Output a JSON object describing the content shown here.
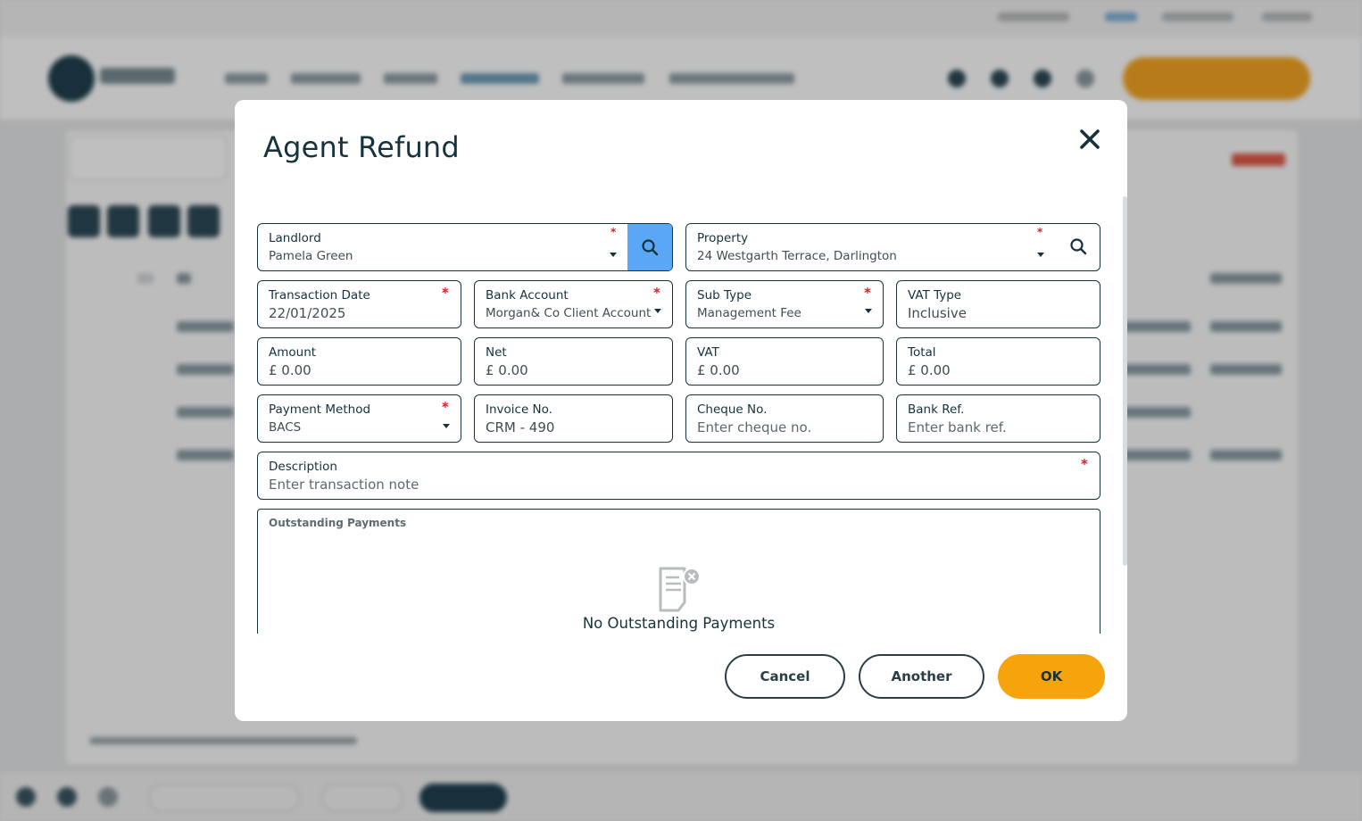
{
  "modal": {
    "title": "Agent Refund",
    "close_icon": "close-icon",
    "fields": {
      "landlord": {
        "label": "Landlord",
        "value": "Pamela Green",
        "required_mark": "*"
      },
      "property": {
        "label": "Property",
        "value": "24 Westgarth Terrace, Darlington",
        "required_mark": "*"
      },
      "transaction_date": {
        "label": "Transaction Date",
        "value": "22/01/2025",
        "required_mark": "*"
      },
      "bank_account": {
        "label": "Bank Account",
        "value": "Morgan& Co Client Account",
        "required_mark": "*"
      },
      "sub_type": {
        "label": "Sub Type",
        "value": "Management Fee",
        "required_mark": "*"
      },
      "vat_type": {
        "label": "VAT Type",
        "value": "Inclusive"
      },
      "amount": {
        "label": "Amount",
        "value": "£ 0.00"
      },
      "net": {
        "label": "Net",
        "value": "£ 0.00"
      },
      "vat": {
        "label": "VAT",
        "value": "£ 0.00"
      },
      "total": {
        "label": "Total",
        "value": "£ 0.00"
      },
      "payment_method": {
        "label": "Payment Method",
        "value": "BACS",
        "required_mark": "*"
      },
      "invoice_no": {
        "label": "Invoice No.",
        "value": "CRM - 490"
      },
      "cheque_no": {
        "label": "Cheque No.",
        "placeholder": "Enter cheque no."
      },
      "bank_ref": {
        "label": "Bank Ref.",
        "placeholder": "Enter bank ref."
      },
      "description": {
        "label": "Description",
        "placeholder": "Enter transaction note",
        "required_mark": "*"
      }
    },
    "outstanding": {
      "label": "Outstanding Payments",
      "empty_icon": "document-remove-icon",
      "empty_text": "No Outstanding Payments"
    },
    "buttons": {
      "cancel": "Cancel",
      "another": "Another",
      "ok": "OK"
    }
  },
  "colors": {
    "primary_dark": "#17323d",
    "accent_orange": "#f7a30b",
    "search_blue": "#5aa8f5",
    "required_red": "#d0252a"
  }
}
